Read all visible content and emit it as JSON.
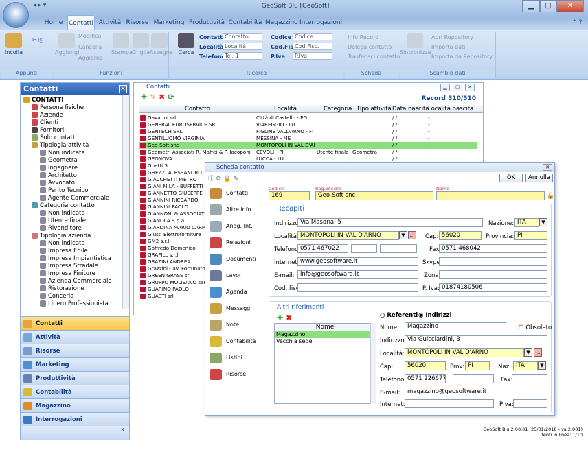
{
  "app": {
    "title": "GeoSoft Blu [GeoSoft]"
  },
  "ribbon": {
    "tabs": [
      "Home",
      "Contatti",
      "Attività",
      "Risorse",
      "Marketing",
      "Produttività",
      "Contabilità",
      "Magazzino",
      "Interrogazioni"
    ],
    "active_tab": "Contatti",
    "groups": {
      "appunti": "Appunti",
      "funzioni": "Funzioni",
      "ricerca": "Ricerca",
      "scheda": "Scheda",
      "scambio": "Scambio dati"
    },
    "buttons": {
      "incolla": "Incolla",
      "modifica": "Modifica",
      "aggiungi": "Aggiungi",
      "cancella": "Cancella",
      "aggiorna": "Aggiorna",
      "stampa": "Stampa",
      "griglia": "Griglia",
      "assegna": "Assegna",
      "cerca": "Cerca",
      "info_record": "Info Record",
      "delega": "Delega contatto",
      "trasferisci": "Trasferisci contatto",
      "sincronizza": "Sincronizza",
      "apri_repo": "Apri Repository",
      "importa_dati": "Importa dati",
      "importa_repo": "Importa da Repository"
    },
    "search": {
      "contatto_label": "Contatto",
      "contatto_ph": "Contatto",
      "localita_label": "Località",
      "localita_ph": "Località",
      "telefono_label": "Telefono",
      "telefono_ph": "Tel. 1",
      "codice_label": "Codice",
      "codice_ph": "Codice",
      "codfisc_label": "Cod.Fisc.",
      "codfisc_ph": "Cod.Fisc.",
      "piva_label": "P.Iva",
      "piva_ph": "P.Iva"
    }
  },
  "left_panel": {
    "title": "Contatti",
    "tree": [
      "CONTATTI",
      "Persone fisiche",
      "Aziende",
      "Clienti",
      "Fornitori",
      "Solo contatti",
      "Tipologia attività",
      "Non indicata",
      "Geometra",
      "Ingegnere",
      "Architetto",
      "Avvocato",
      "Perito Tecnico",
      "Agente Commerciale",
      "Categoria contatto",
      "Non indicata",
      "Utente finale",
      "Rivenditore",
      "Tipologia azienda",
      "Non indicata",
      "Impresa Edile",
      "Impresa Impiantistica",
      "Impresa Stradale",
      "Impresa Finiture",
      "Azienda Commerciale",
      "Ristorazione",
      "Conceria",
      "Libero Professionista"
    ],
    "nav": [
      "Contatti",
      "Attività",
      "Risorse",
      "Marketing",
      "Produttività",
      "Contabilità",
      "Magazzino",
      "Interrogazioni"
    ]
  },
  "contacts_window": {
    "title": "Contatti",
    "record": "Record 510/510",
    "columns": [
      "Contatto",
      "Località",
      "Categoria",
      "Tipo attività",
      "Data nascita",
      "Località nascita"
    ],
    "rows": [
      [
        "Gavarini srl",
        "Città di Castello - PG",
        "",
        "",
        "/ /",
        "-"
      ],
      [
        "GENERAL EUROSERVICE SRL",
        "VIAREGGIO - LU",
        "",
        "",
        "/ /",
        "-"
      ],
      [
        "GENTECH SRL",
        "FIGLINE VALDARNO - FI",
        "",
        "",
        "/ /",
        "-"
      ],
      [
        "GENTILUOMO VIRGINIA",
        "MESSINA - ME",
        "",
        "",
        "/ /",
        "-"
      ],
      [
        "Geo-Soft snc",
        "MONTOPOLI IN VAL D'ARNO",
        "",
        "",
        "/ /",
        "-"
      ],
      [
        "Geometri Associati R. Maffei & P. Iacoponi",
        "CEVOLI - PI",
        "Utente finale",
        "Geometra",
        "/ /",
        "-"
      ],
      [
        "GEONOVA",
        "LUCCA - LU",
        "",
        "",
        "/ /",
        ""
      ],
      [
        "Ghetti 3",
        "",
        "",
        "",
        "",
        ""
      ],
      [
        "GHEZZI ALESSANDRO",
        "",
        "",
        "",
        "",
        ""
      ],
      [
        "GIACCHETTI PIETRO",
        "",
        "",
        "",
        "",
        ""
      ],
      [
        "GIANI MILA - BUFFETTI",
        "",
        "",
        "",
        "",
        ""
      ],
      [
        "GIANNETTO GIUSEPPE",
        "",
        "",
        "",
        "",
        ""
      ],
      [
        "GIANNINI RICCARDO",
        "",
        "",
        "",
        "",
        ""
      ],
      [
        "GIANNINI PAOLO",
        "",
        "",
        "",
        "",
        ""
      ],
      [
        "GIANNONI & ASSOCIATI St",
        "",
        "",
        "",
        "",
        ""
      ],
      [
        "GIANOLA S.p.a",
        "",
        "",
        "",
        "",
        ""
      ],
      [
        "GIARDINA MARIO CARMEL",
        "",
        "",
        "",
        "",
        ""
      ],
      [
        "Giusti Elettroforniture",
        "",
        "",
        "",
        "",
        ""
      ],
      [
        "GM2 s.r.l.",
        "",
        "",
        "",
        "",
        ""
      ],
      [
        "Goffredo Domenico",
        "",
        "",
        "",
        "",
        ""
      ],
      [
        "GRAFILL s.r.l.",
        "",
        "",
        "",
        "",
        ""
      ],
      [
        "GRAZINI ANDREA",
        "",
        "",
        "",
        "",
        ""
      ],
      [
        "Grazzini Cav. Fortunato S.p",
        "",
        "",
        "",
        "",
        ""
      ],
      [
        "GREEN GRASS srl",
        "",
        "",
        "",
        "",
        ""
      ],
      [
        "GRUPPO MOLISANO sas di",
        "",
        "",
        "",
        "",
        ""
      ],
      [
        "GUARINO PAOLO",
        "",
        "",
        "",
        "",
        ""
      ],
      [
        "GUASTI srl",
        "",
        "",
        "",
        "",
        ""
      ]
    ]
  },
  "dialog": {
    "title": "Scheda contatto",
    "ok": "OK",
    "annulla": "Annulla",
    "side": [
      "Contatti",
      "Altre info",
      "Anag. Int.",
      "Relazioni",
      "Documenti",
      "Lavori",
      "Agenda",
      "Messaggi",
      "Note",
      "Contabilità",
      "Listini",
      "Risorse"
    ],
    "codice_label": "Codice",
    "codice": "169",
    "ragsoc_label": "Rag.Sociale",
    "ragsoc": "Geo-Soft snc",
    "nome_label": "Nome",
    "nome": "",
    "recapiti": "Recapiti",
    "indirizzo_label": "Indirizzo:",
    "indirizzo": "Via Masoria, 5",
    "nazione_label": "Nazione:",
    "nazione": "ITA",
    "localita_label": "Località:",
    "localita": "MONTOPOLI IN VAL D'ARNO",
    "cap_label": "Cap:",
    "cap": "56020",
    "provincia_label": "Provincia:",
    "provincia": "PI",
    "telefono_label": "Telefono:",
    "telefono": "0571 467022",
    "fax_label": "Fax:",
    "fax": "0571 468042",
    "internet_label": "Internet:",
    "internet": "www.geosoftware.it",
    "skype_label": "Skype:",
    "email_label": "E-mail:",
    "email": "info@geosoftware.it",
    "zona_label": "Zona:",
    "codfisc_label": "Cod. fisc.:",
    "piva_label": "P. Iva:",
    "piva": "01874180506",
    "altri": "Altri riferimenti",
    "referenti": "Referenti",
    "indirizzi": "Indirizzi",
    "list_header": "Nome",
    "list": [
      "Magazzino",
      "Vecchia sede"
    ],
    "r_nome_label": "Nome:",
    "r_nome": "Magazzino",
    "obsoleto": "Obsoleto",
    "r_indirizzo_label": "Indirizzo:",
    "r_indirizzo": "Via Guicciardini, 3",
    "r_localita_label": "Località:",
    "r_localita": "MONTOPOLI IN VAL D'ARNO",
    "r_cap_label": "Cap:",
    "r_cap": "56020",
    "r_prov_label": "Prov:",
    "r_prov": "PI",
    "r_naz_label": "Naz:",
    "r_naz": "ITA",
    "r_telefono_label": "Telefono:",
    "r_telefono": "0571 226677",
    "r_fax_label": "Fax:",
    "r_email_label": "E-mail:",
    "r_email": "magazzino@geosoftware.it",
    "r_internet_label": "Internet:",
    "r_piva_label": "PIva:"
  },
  "status": {
    "line1": "GeoSoft Blu 2.00.01 (25/01/2018 - va 2.001)",
    "line2": "Utenti in linea: 1/10"
  },
  "colors": {
    "accent": "#2a5fb0",
    "selected_row": "#8ae07d",
    "mandatory": "#ffffb8"
  }
}
